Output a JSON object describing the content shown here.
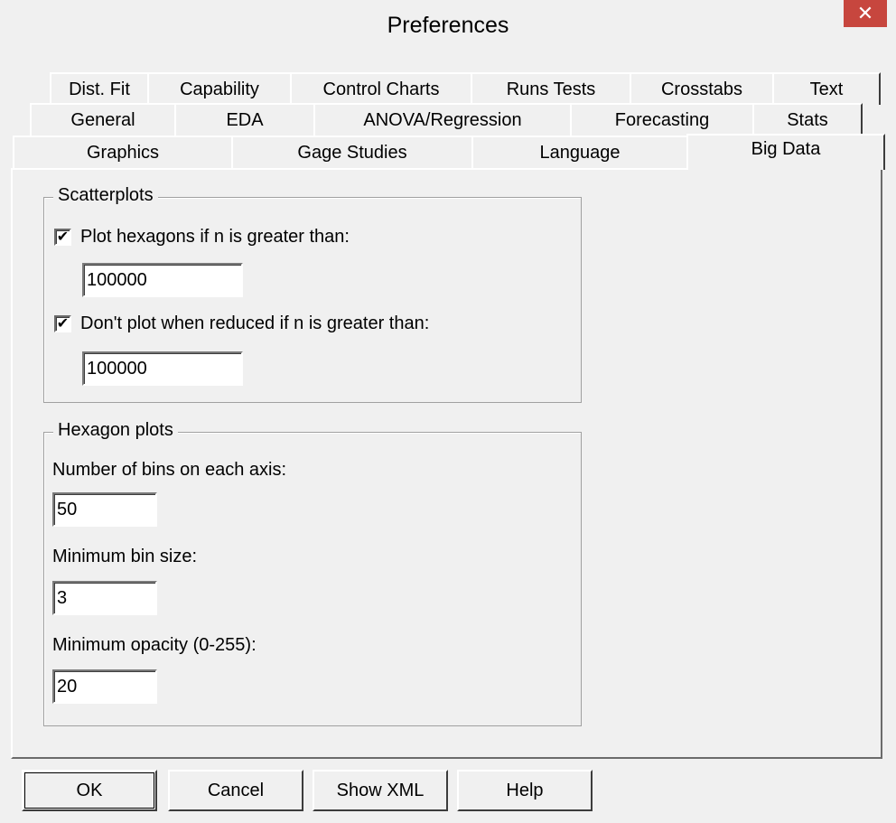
{
  "window": {
    "title": "Preferences",
    "close_glyph": "✕"
  },
  "tabs": {
    "row1": [
      "Dist. Fit",
      "Capability",
      "Control Charts",
      "Runs Tests",
      "Crosstabs",
      "Text"
    ],
    "row2": [
      "General",
      "EDA",
      "ANOVA/Regression",
      "Forecasting",
      "Stats"
    ],
    "row3": [
      "Graphics",
      "Gage Studies",
      "Language",
      "Big Data"
    ],
    "active": "Big Data"
  },
  "scatterplots": {
    "title": "Scatterplots",
    "hexagons_check_label": "Plot hexagons if n is greater than:",
    "hexagons_checked": true,
    "hexagons_value": "100000",
    "reduced_check_label": "Don't plot when reduced if n is greater than:",
    "reduced_checked": true,
    "reduced_value": "100000"
  },
  "hexagon_plots": {
    "title": "Hexagon plots",
    "bins_label": "Number of bins on each axis:",
    "bins_value": "50",
    "min_bin_label": "Minimum bin size:",
    "min_bin_value": "3",
    "opacity_label": "Minimum opacity (0-255):",
    "opacity_value": "20"
  },
  "buttons": {
    "ok": "OK",
    "cancel": "Cancel",
    "show_xml": "Show XML",
    "help": "Help"
  },
  "check_glyph": "✔"
}
